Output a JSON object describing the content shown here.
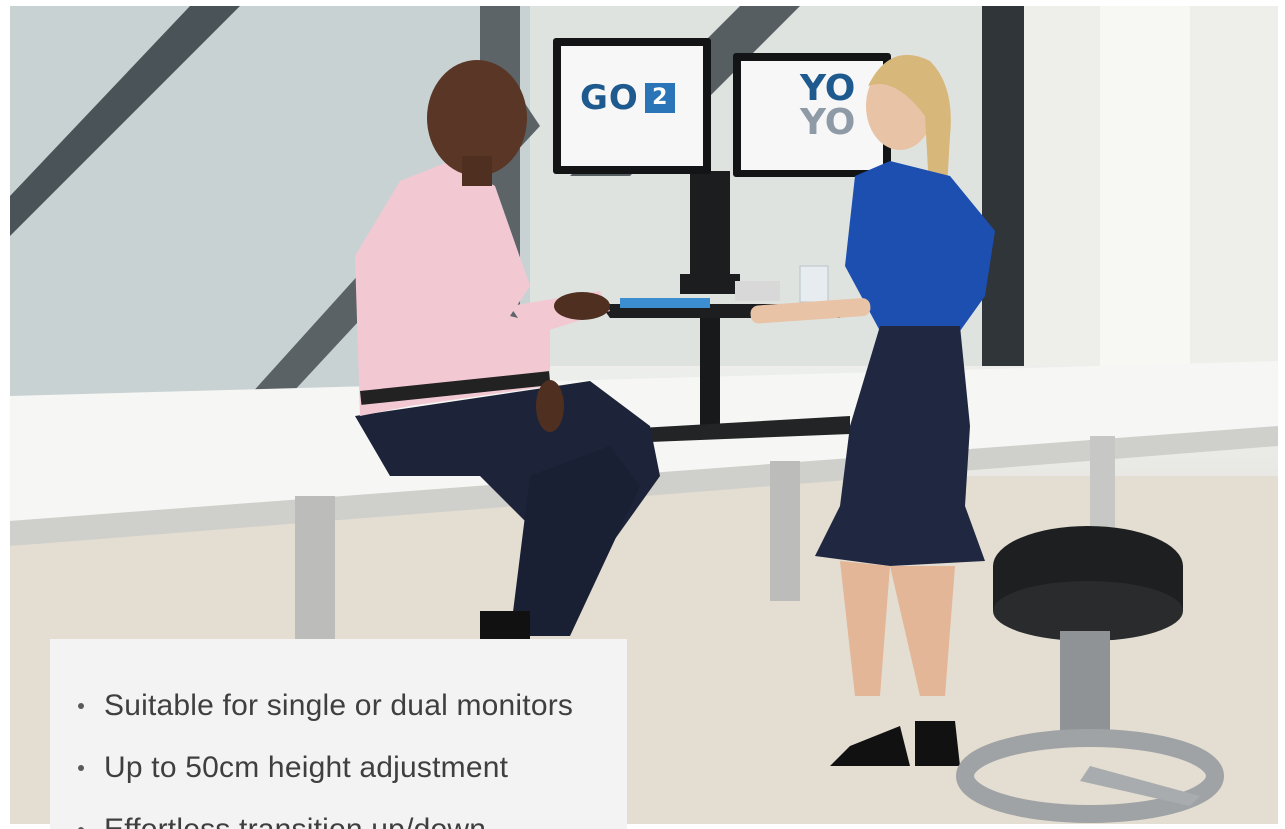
{
  "hero": {
    "monitor_left_logo": "GO",
    "monitor_left_badge": "2",
    "monitor_right_logo_line1": "YO",
    "monitor_right_logo_line2": "YO",
    "colors": {
      "logo_blue": "#1f5a8f",
      "badge_blue": "#2a74b8",
      "shirt_pink": "#f2c9d3",
      "blouse_blue": "#1d4fb0",
      "skirt_navy": "#202740"
    }
  },
  "features": {
    "items": [
      "Suitable for single or dual monitors",
      "Up to 50cm height adjustment",
      "Effortless transition up/down"
    ]
  }
}
